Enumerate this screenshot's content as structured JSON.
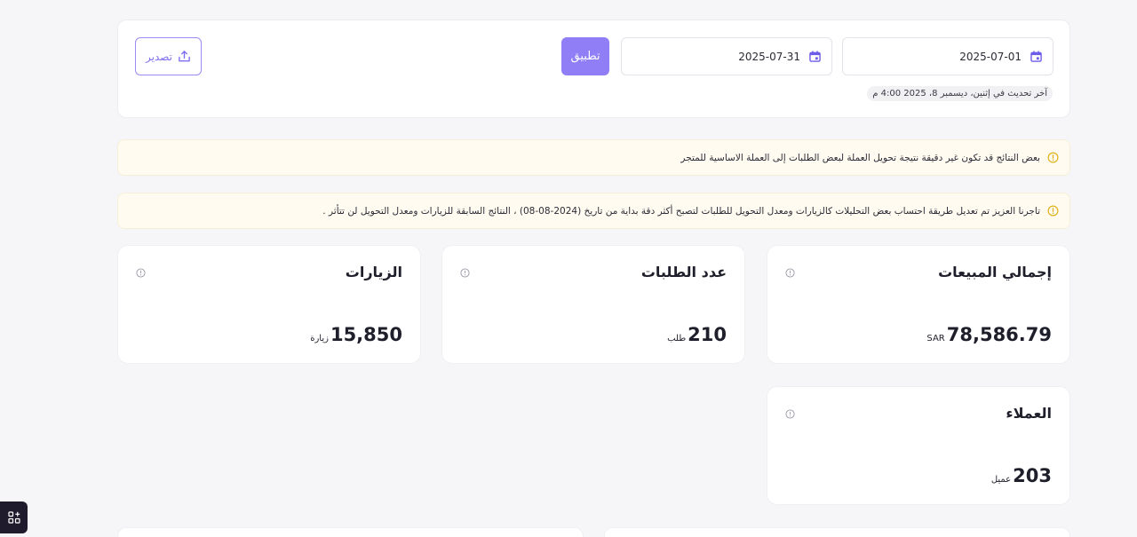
{
  "filters": {
    "from_date": "2025-07-01",
    "to_date": "2025-07-31",
    "apply_label": "تطبيق",
    "export_label": "تصدير",
    "last_updated": "آخر تحديث في إثنين، ديسمبر 8، 2025 4:00 م"
  },
  "notices": [
    "بعض النتائج قد تكون غير دقيقة نتيجة تحويل العملة لبعض الطلبات إلى العملة الاساسية للمتجر",
    "تاجرنا العزيز تم تعديل طريقة احتساب بعض التحليلات كالزيارات ومعدل التحويل للطلبات لتصبح أكثر دقة بداية من تاريخ (2024-08-08) ، النتائج السابقة للزيارات ومعدل التحويل لن تتأثر ."
  ],
  "stats": {
    "sales": {
      "title": "إجمالي المبيعات",
      "value": "78,586.79",
      "unit": "SAR"
    },
    "orders": {
      "title": "عدد الطلبات",
      "value": "210",
      "unit": "طلب"
    },
    "visits": {
      "title": "الزيارات",
      "value": "15,850",
      "unit": "زيارة"
    },
    "customers": {
      "title": "العملاء",
      "value": "203",
      "unit": "عميل"
    }
  },
  "icons": {
    "calendar": "calendar-icon",
    "export": "upload-icon",
    "warning": "alert-circle-icon",
    "info": "info-icon",
    "widget": "apps-add-icon"
  },
  "colors": {
    "accent": "#8f7ef6",
    "notice_bg": "#fffbf0",
    "warning": "#e2b21c"
  }
}
